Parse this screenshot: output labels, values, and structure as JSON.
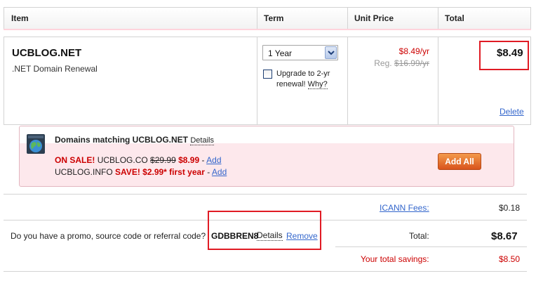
{
  "header": {
    "item": "Item",
    "term": "Term",
    "unit_price": "Unit Price",
    "total": "Total"
  },
  "item": {
    "domain": "UCBLOG.NET",
    "description": ".NET Domain Renewal",
    "term_selected": "1 Year",
    "upgrade_text_1": "Upgrade to 2-yr",
    "upgrade_text_2": "renewal!",
    "why": "Why?",
    "price": "$8.49/yr",
    "reg_label": "Reg.",
    "reg_price": "$16.99/yr",
    "total": "$8.49",
    "delete": "Delete"
  },
  "suggestions": {
    "title": "Domains matching UCBLOG.NET",
    "details": "Details",
    "line1": {
      "sale": "ON SALE!",
      "domain": "UCBLOG.CO",
      "old_price": "$29.99",
      "new_price": "$8.99",
      "sep": "-",
      "add": "Add"
    },
    "line2": {
      "domain": "UCBLOG.INFO",
      "save": "SAVE! $2.99* first year",
      "sep": "-",
      "add": "Add"
    },
    "add_all": "Add All"
  },
  "totals": {
    "icann_label": "ICANN Fees:",
    "icann_value": "$0.18",
    "promo_question": "Do you have a promo, source code or referral code?",
    "promo_code": "GDBBREN8",
    "promo_details": "Details",
    "promo_remove": "Remove",
    "total_label": "Total:",
    "total_value": "$8.67",
    "savings_label": "Your total savings:",
    "savings_value": "$8.50"
  },
  "colors": {
    "accent_red": "#cc0000",
    "link_blue": "#3366cc",
    "highlight_red": "#e01b24",
    "add_all_orange": "#e8702e"
  }
}
